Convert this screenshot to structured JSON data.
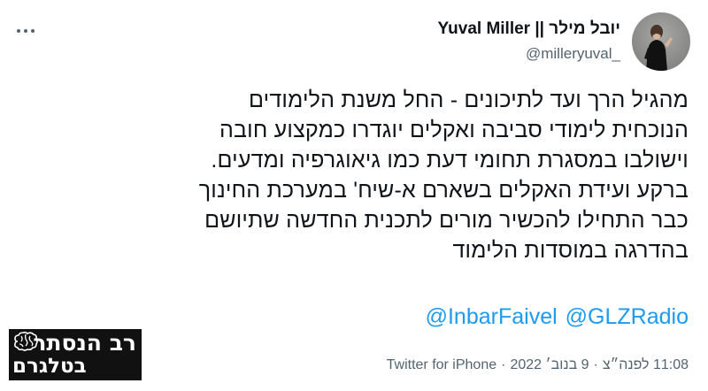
{
  "tweet": {
    "display_name": "יובל מילר || Yuval Miller",
    "handle": "@milleryuval_",
    "avatar_icon": "profile-avatar",
    "more_icon": "more-options-icon",
    "text": "מהגיל הרך ועד לתיכונים - החל משנת הלימודים\nהנוכחית לימודי סביבה ואקלים יוגדרו כמקצוע חובה\nוישולבו במסגרת תחומי דעת כמו גיאוגרפיה ומדעים.\nברקע ועידת האקלים בשארם א-שיח' במערכת החינוך\nכבר התחילו להכשיר מורים לתכנית החדשה שתיושם\nבהדרגה במוסדות הלימוד",
    "mentions": [
      "@InbarFaivel",
      "@GLZRadio"
    ],
    "time": "11:08 לפנה״צ",
    "date": "9 בנוב׳ 2022",
    "source": "Twitter for iPhone",
    "separator": "·"
  },
  "watermark": {
    "line1": "רב הנסתר",
    "line2": "בטלגרם",
    "icon": "brain-icon"
  },
  "colors": {
    "text": "#0f1419",
    "secondary": "#536471",
    "link": "#1d9bf0",
    "watermark_bg": "#111111"
  }
}
